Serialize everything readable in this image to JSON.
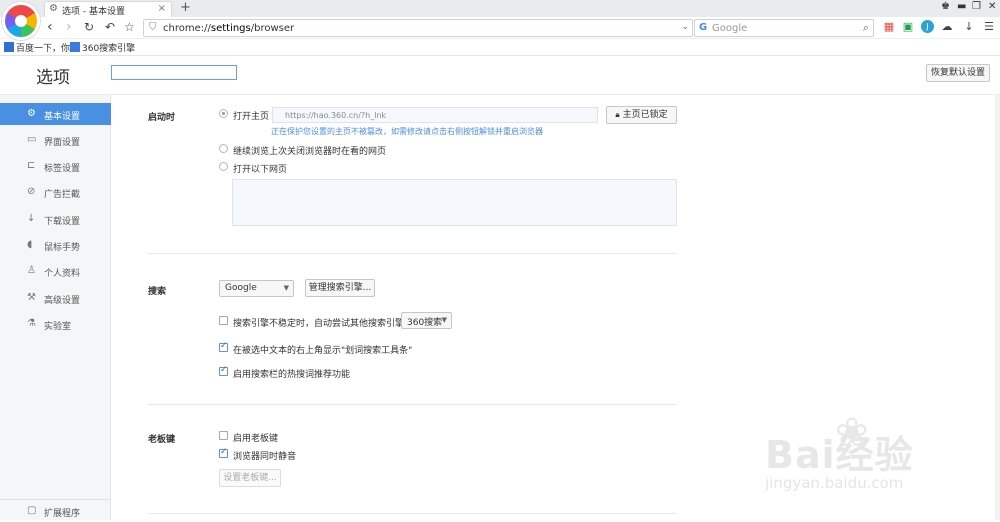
{
  "tab": {
    "title": "选项 - 基本设置"
  },
  "address_bar": {
    "url_prefix": "chrome://",
    "url_bold": "settings",
    "url_suffix": "/browser"
  },
  "search_bar": {
    "engine_placeholder": "Google"
  },
  "bookmarks": [
    {
      "label": "百度一下，你"
    },
    {
      "label": "360搜索引擎"
    }
  ],
  "page": {
    "title": "选项",
    "search_value": "",
    "restore_defaults": "恢复默认设置"
  },
  "sidebar": {
    "items": [
      {
        "label": "基本设置",
        "icon": "gear-icon",
        "active": true
      },
      {
        "label": "界面设置",
        "icon": "window-icon"
      },
      {
        "label": "标签设置",
        "icon": "tab-icon"
      },
      {
        "label": "广告拦截",
        "icon": "block-icon"
      },
      {
        "label": "下载设置",
        "icon": "download-icon"
      },
      {
        "label": "鼠标手势",
        "icon": "mouse-icon"
      },
      {
        "label": "个人资料",
        "icon": "user-icon"
      },
      {
        "label": "高级设置",
        "icon": "advanced-icon"
      },
      {
        "label": "实验室",
        "icon": "lab-icon"
      }
    ],
    "extensions": {
      "label": "扩展程序",
      "icon": "extension-icon"
    }
  },
  "startup": {
    "label": "启动时",
    "open_home": "打开主页",
    "home_url": "https://hao.360.cn/?h_lnk",
    "lock_button": "主页已锁定",
    "protect_note": "正在保护您设置的主页不被篡改，如需修改请点击右侧按钮解锁并重启浏览器",
    "continue_last": "继续浏览上次关闭浏览器时在看的网页",
    "open_pages": "打开以下网页"
  },
  "search": {
    "label": "搜索",
    "engine_select": "Google",
    "manage_button": "管理搜索引擎...",
    "fallback_text": "搜索引擎不稳定时，自动尝试其他搜索引擎：",
    "fallback_select": "360搜索",
    "fallback_checked": false,
    "selection_toolbar": "在被选中文本的右上角显示\"划词搜索工具条\"",
    "selection_toolbar_checked": true,
    "hot_words": "启用搜索栏的热搜词推荐功能",
    "hot_words_checked": true
  },
  "boss_key": {
    "label": "老板键",
    "enable": "启用老板键",
    "enable_checked": false,
    "mute": "浏览器同时静音",
    "mute_checked": true,
    "setup_button": "设置老板键..."
  },
  "watermark": {
    "main": "Bai经验",
    "sub": "jingyan.baidu.com"
  },
  "colors": {
    "accent": "#4a90e2",
    "note": "#4a8fe0"
  }
}
